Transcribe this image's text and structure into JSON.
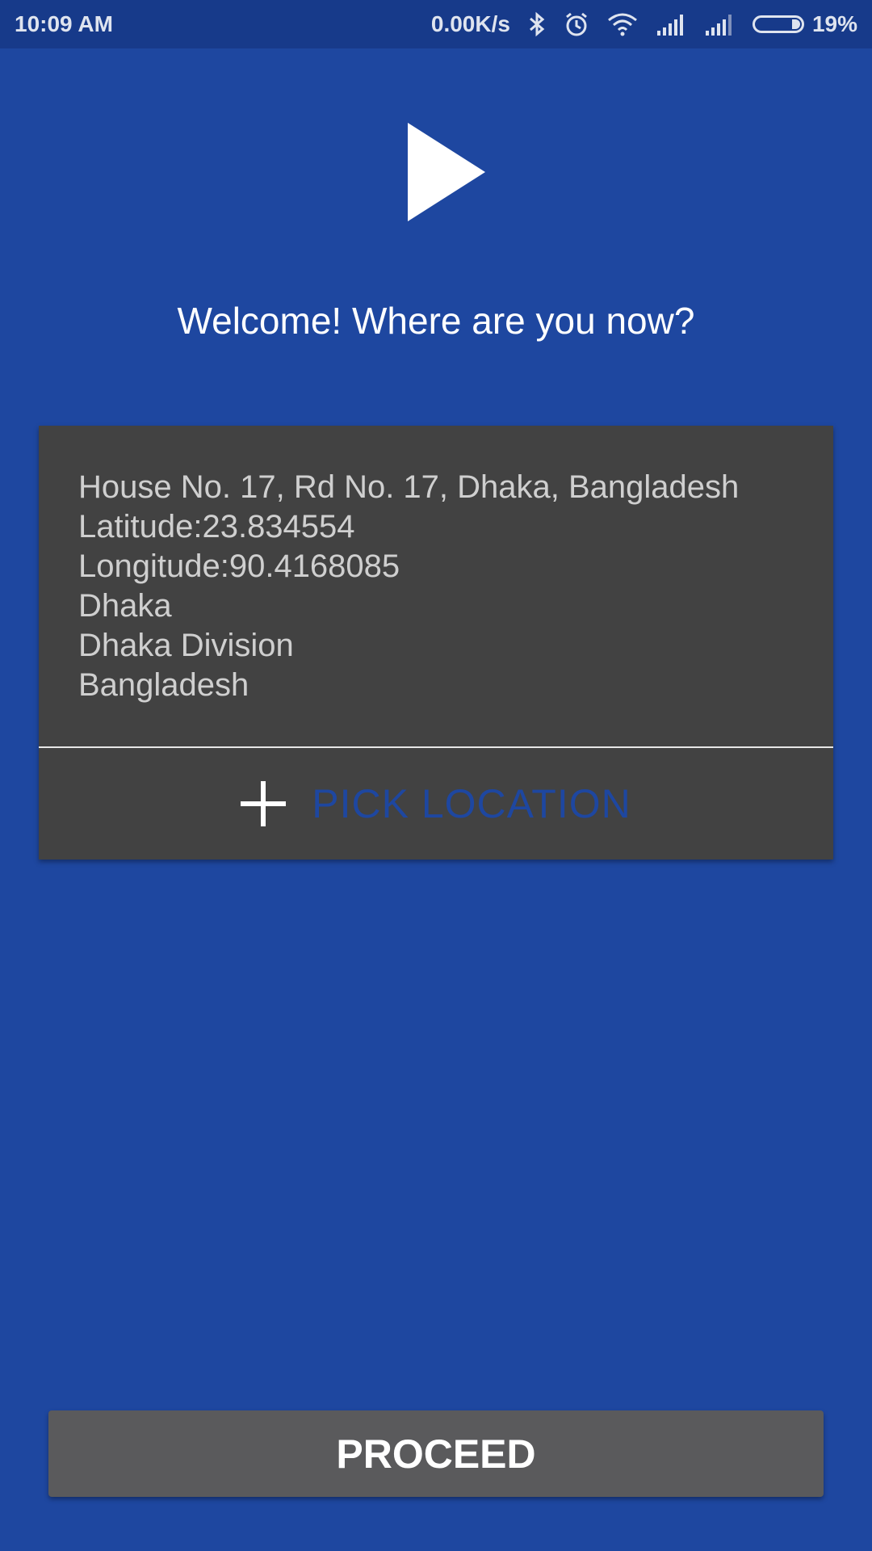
{
  "status_bar": {
    "time": "10:09 AM",
    "net_speed": "0.00K/s",
    "battery": "19%",
    "battery_level": 0.19,
    "icons": [
      "bluetooth-icon",
      "alarm-icon",
      "wifi-icon",
      "signal-icon",
      "signal-icon",
      "battery-icon"
    ]
  },
  "logo": {
    "icon": "play-triangle-icon",
    "color": "#ffffff"
  },
  "welcome": {
    "title": "Welcome! Where are you now?"
  },
  "location_card": {
    "lines": [
      "House No. 17, Rd No. 17, Dhaka, Bangladesh",
      "Latitude:23.834554",
      "Longitude:90.4168085",
      "Dhaka",
      "Dhaka Division",
      "Bangladesh"
    ],
    "pick_label": "PICK LOCATION",
    "pick_icon": "plus-icon"
  },
  "proceed_button": {
    "label": "PROCEED"
  },
  "colors": {
    "background": "#1e47a0",
    "status_bar": "#173a8a",
    "card": "#424242",
    "button": "#5a5a5c",
    "accent": "#1e47a0"
  }
}
